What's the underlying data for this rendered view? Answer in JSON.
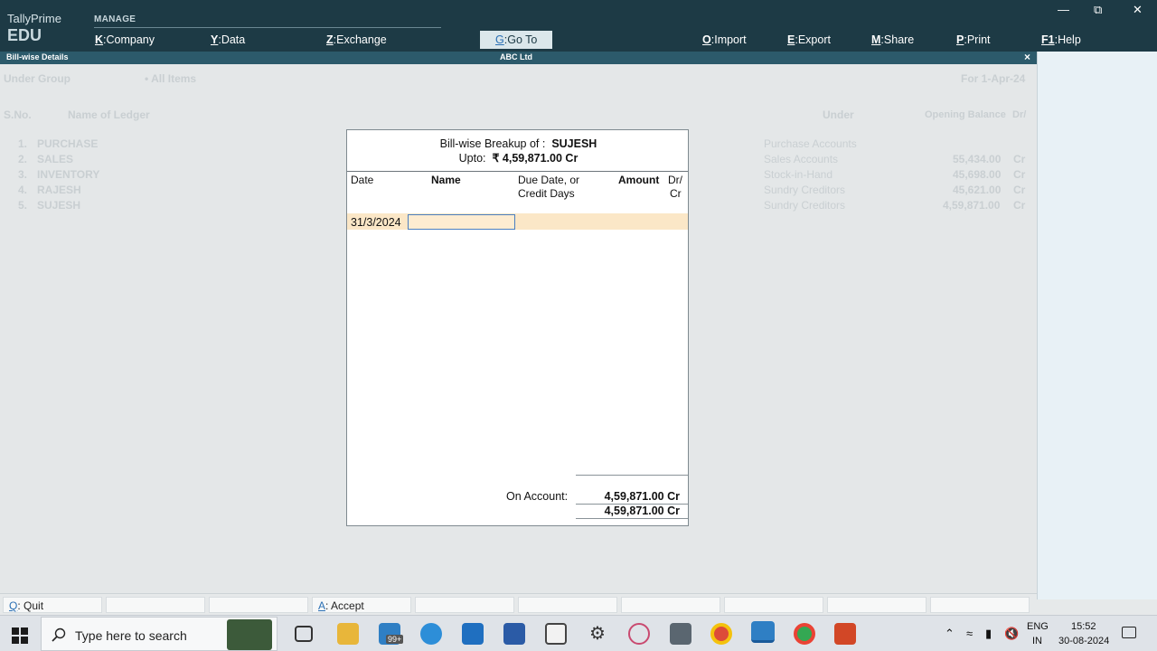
{
  "app": {
    "product": "TallyPrime",
    "edition": "EDU",
    "menu_group": "MANAGE"
  },
  "menu": [
    {
      "key": "K",
      "label": "Company"
    },
    {
      "key": "Y",
      "label": "Data"
    },
    {
      "key": "Z",
      "label": "Exchange"
    },
    {
      "key": "G",
      "label": "Go To"
    },
    {
      "key": "O",
      "label": "Import"
    },
    {
      "key": "E",
      "label": "Export"
    },
    {
      "key": "M",
      "label": "Share"
    },
    {
      "key": "P",
      "label": "Print"
    },
    {
      "key": "F1",
      "label": "Help"
    }
  ],
  "title_strip": {
    "left": "Bill-wise Details",
    "center": "ABC Ltd",
    "close": "×"
  },
  "background": {
    "under_group_label": "Under Group",
    "filter": "• All Items",
    "period": "For 1-Apr-24",
    "col_sno": "S.No.",
    "col_name": "Name of Ledger",
    "col_under": "Under",
    "col_opening": "Opening Balance",
    "col_drcr": "Dr/",
    "rows": [
      {
        "sno": "1.",
        "name": "PURCHASE",
        "under": "Purchase Accounts",
        "balance": "",
        "drcr": ""
      },
      {
        "sno": "2.",
        "name": "SALES",
        "under": "Sales Accounts",
        "balance": "55,434.00",
        "drcr": "Cr"
      },
      {
        "sno": "3.",
        "name": "INVENTORY",
        "under": "Stock-in-Hand",
        "balance": "45,698.00",
        "drcr": "Cr"
      },
      {
        "sno": "4.",
        "name": "RAJESH",
        "under": "Sundry Creditors",
        "balance": "45,621.00",
        "drcr": "Cr"
      },
      {
        "sno": "5.",
        "name": "SUJESH",
        "under": "Sundry Creditors",
        "balance": "4,59,871.00",
        "drcr": "Cr"
      }
    ]
  },
  "dialog": {
    "title_prefix": "Bill-wise Breakup of :",
    "ledger": "SUJESH",
    "upto_label": "Upto:",
    "upto_value": "₹ 4,59,871.00 Cr",
    "col_date": "Date",
    "col_name": "Name",
    "col_due_1": "Due Date, or",
    "col_due_2": "Credit Days",
    "col_amount": "Amount",
    "col_drcr_1": "Dr/",
    "col_drcr_2": "Cr",
    "entry_date": "31/3/2024",
    "entry_name": "",
    "on_account_label": "On Account:",
    "on_account_value": "4,59,871.00 Cr",
    "total_value": "4,59,871.00 Cr"
  },
  "buttons": [
    {
      "key": "Q",
      "label": "Quit"
    },
    {
      "key": "A",
      "label": "Accept"
    }
  ],
  "taskbar": {
    "search_placeholder": "Type here to search",
    "mail_badge": "99+",
    "lang_1": "ENG",
    "lang_2": "IN",
    "time": "15:52",
    "date": "30-08-2024"
  }
}
